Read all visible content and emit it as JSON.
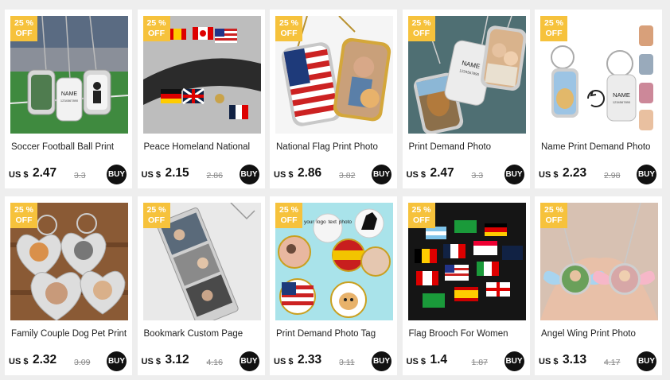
{
  "colors": {
    "badge": "#f6c23c",
    "buy_button": "#111111",
    "card": "#ffffff",
    "background": "#eeeeee"
  },
  "products": [
    {
      "title": "Soccer Football Ball Print",
      "discount_pct": "25 %",
      "discount_off": "OFF",
      "currency": "US $",
      "price": "2.47",
      "old_price": "3.3",
      "buy_label": "BUY"
    },
    {
      "title": "Peace Homeland National",
      "discount_pct": "25 %",
      "discount_off": "OFF",
      "currency": "US $",
      "price": "2.15",
      "old_price": "2.86",
      "buy_label": "BUY"
    },
    {
      "title": "National Flag Print Photo",
      "discount_pct": "25 %",
      "discount_off": "OFF",
      "currency": "US $",
      "price": "2.86",
      "old_price": "3.82",
      "buy_label": "BUY"
    },
    {
      "title": "Print Demand Photo",
      "discount_pct": "25 %",
      "discount_off": "OFF",
      "currency": "US $",
      "price": "2.47",
      "old_price": "3.3",
      "buy_label": "BUY"
    },
    {
      "title": "Name Print Demand Photo",
      "discount_pct": "25 %",
      "discount_off": "OFF",
      "currency": "US $",
      "price": "2.23",
      "old_price": "2.98",
      "buy_label": "BUY"
    },
    {
      "title": "Family Couple Dog Pet Print",
      "discount_pct": "25 %",
      "discount_off": "OFF",
      "currency": "US $",
      "price": "2.32",
      "old_price": "3.09",
      "buy_label": "BUY"
    },
    {
      "title": "Bookmark Custom Page",
      "discount_pct": "25 %",
      "discount_off": "OFF",
      "currency": "US $",
      "price": "3.12",
      "old_price": "4.16",
      "buy_label": "BUY"
    },
    {
      "title": "Print Demand Photo Tag",
      "discount_pct": "25 %",
      "discount_off": "OFF",
      "currency": "US $",
      "price": "2.33",
      "old_price": "3.11",
      "buy_label": "BUY"
    },
    {
      "title": "Flag Brooch For Women",
      "discount_pct": "25 %",
      "discount_off": "OFF",
      "currency": "US $",
      "price": "1.4",
      "old_price": "1.87",
      "buy_label": "BUY"
    },
    {
      "title": "Angel Wing Print Photo",
      "discount_pct": "25 %",
      "discount_off": "OFF",
      "currency": "US $",
      "price": "3.13",
      "old_price": "4.17",
      "buy_label": "BUY"
    }
  ],
  "image_text": {
    "name_tag": "NAME",
    "number_tag": "1234567890",
    "logo_sticker": "your logo text photo"
  }
}
